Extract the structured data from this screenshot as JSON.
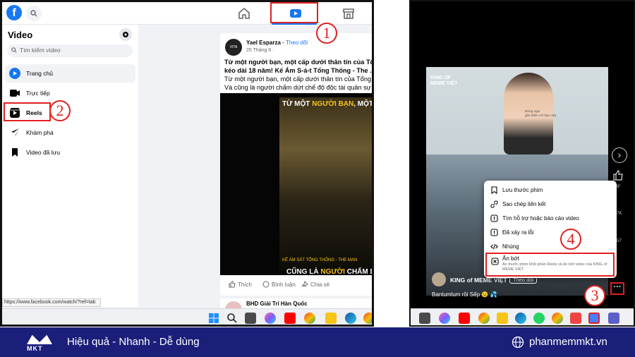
{
  "left": {
    "sidebar": {
      "title": "Video",
      "search_placeholder": "Tìm kiếm video",
      "items": [
        {
          "label": "Trang chủ",
          "icon": "play-icon"
        },
        {
          "label": "Trực tiếp",
          "icon": "live-icon"
        },
        {
          "label": "Reels",
          "icon": "reels-icon"
        },
        {
          "label": "Khám phá",
          "icon": "explore-icon"
        },
        {
          "label": "Video đã lưu",
          "icon": "bookmark-icon"
        }
      ]
    },
    "status_url": "https://www.facebook.com/watch/?ref=tab",
    "post": {
      "avatar_text": "VITA",
      "author": "Yael Esparza",
      "follow": "Theo dõi",
      "time": "25 Tháng 6 ·",
      "title_line1": "Từ một người bạn, một cấp dưới thân tín của Tổng",
      "title_line2": "kéo dài 18 năm! Kế Ám S-á-t Tổng Thống - The ...",
      "body_line1": "Từ một người bạn, một cấp dưới thân tín của Tổng T",
      "body_line2": "Và cũng là người chấm dứt chế độ độc tài quân sự d",
      "video_caption_top_a": "TỪ MỘT ",
      "video_caption_top_b": "NGƯỜI BẠN",
      "video_caption_top_c": ", MỘT",
      "video_subtitle": "KẾ ÁM SÁT TỔNG THỐNG - THE MAN",
      "video_caption_bot_a": "CŨNG LÀ ",
      "video_caption_bot_b": "NGƯỜI",
      "video_caption_bot_c": " CHẤM DỨT C",
      "actions": [
        "Thích",
        "Bình luận",
        "Chia sẻ"
      ]
    },
    "post2_author": "BHD Giải Trí Hàn Quốc",
    "badges": [
      "1",
      "2"
    ]
  },
  "right": {
    "reel_brand": "KING OF\nMEME VIỆT",
    "reel_small_text": "Đừng ngại\ngần thêm với bạn nữa",
    "owner": "KING of MEME VIỆT",
    "follow": "Theo dõi",
    "caption": "Bantumlum rồi Sếp 😉 💦",
    "side_counts": [
      "g!",
      "7K",
      "57"
    ],
    "menu": [
      {
        "label": "Lưu thước phim",
        "icon": "bookmark-icon"
      },
      {
        "label": "Sao chép liên kết",
        "icon": "link-icon"
      },
      {
        "label": "Tìm hỗ trợ hoặc báo cáo video",
        "icon": "report-icon"
      },
      {
        "label": "Đã xảy ra lỗi",
        "icon": "warning-icon"
      },
      {
        "label": "Nhúng",
        "icon": "embed-icon"
      }
    ],
    "hide": {
      "label": "Ẩn bớt",
      "desc": "Ẩn thước phim khỏi phần Reels và ẩn bớt video của KING of MEME VIỆT."
    },
    "more_label": "···",
    "badges": [
      "3",
      "4"
    ]
  },
  "brand": {
    "logo_text": "MKT",
    "tagline": "Hiệu quả - Nhanh - Dễ dùng",
    "site": "phanmemmkt.vn"
  },
  "colors": {
    "fb_blue": "#1877f2",
    "highlight_red": "#e02020",
    "brand_bar": "#1b1f7a",
    "caption_yellow": "#f5c518"
  }
}
